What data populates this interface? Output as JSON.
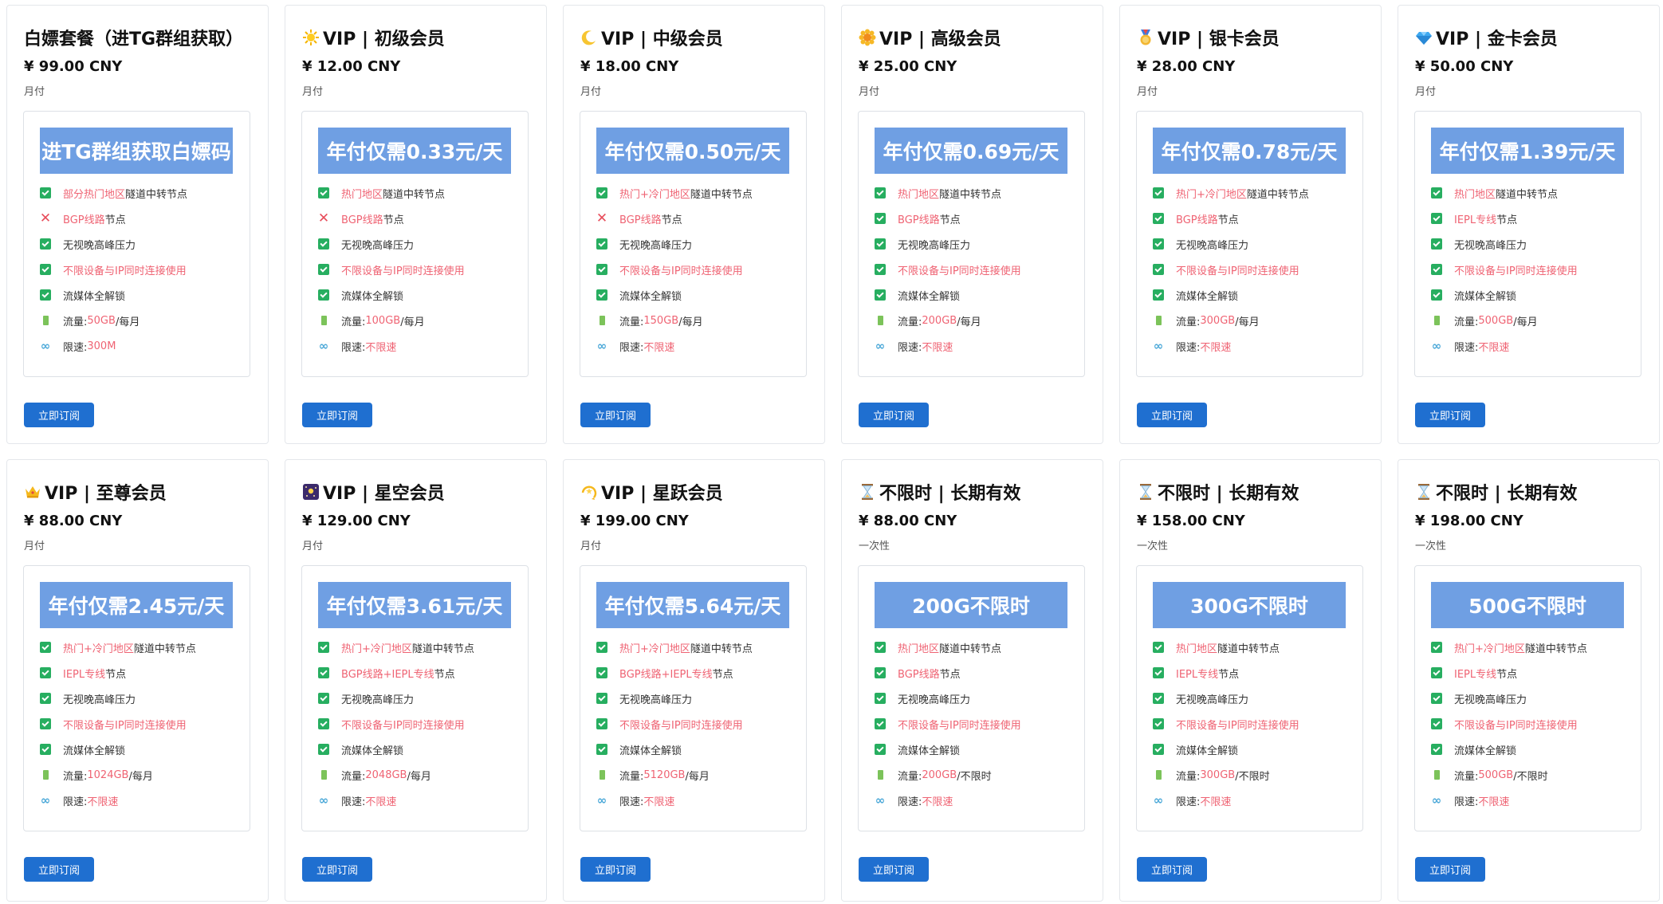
{
  "button_label": "立即订阅",
  "cards": [
    {
      "title": "白嫖套餐（进TG群组获取）",
      "emoji": "",
      "price": "¥ 99.00 CNY",
      "period": "月付",
      "banner": "进TG群组获取白嫖码",
      "features": [
        {
          "icon": "check-icon",
          "red": "部分热门地区",
          "text": " 隧道中转节点"
        },
        {
          "icon": "cross-icon",
          "red": "BGP线路",
          "text": "节点"
        },
        {
          "icon": "check-icon",
          "red": "",
          "text": "无视晚高峰压力"
        },
        {
          "icon": "check-icon",
          "red": "不限设备与IP同时连接使用",
          "text": ""
        },
        {
          "icon": "check-icon",
          "red": "",
          "text": "流媒体全解锁"
        },
        {
          "icon": "battery-icon",
          "text": "流量:",
          "red": "50GB",
          "suffix": " /每月"
        },
        {
          "icon": "infinity-icon",
          "text": "限速:",
          "red": "300M"
        }
      ]
    },
    {
      "title": "VIP | 初级会员",
      "emoji": "sun",
      "price": "¥ 12.00 CNY",
      "period": "月付",
      "banner": "年付仅需0.33元/天",
      "features": [
        {
          "icon": "check-icon",
          "red": "热门地区",
          "text": " 隧道中转节点"
        },
        {
          "icon": "cross-icon",
          "red": "BGP线路",
          "text": "节点"
        },
        {
          "icon": "check-icon",
          "red": "",
          "text": "无视晚高峰压力"
        },
        {
          "icon": "check-icon",
          "red": "不限设备与IP同时连接使用",
          "text": ""
        },
        {
          "icon": "check-icon",
          "red": "",
          "text": "流媒体全解锁"
        },
        {
          "icon": "battery-icon",
          "text": "流量:",
          "red": "100GB",
          "suffix": " /每月"
        },
        {
          "icon": "infinity-icon",
          "text": "限速:",
          "red": "不限速"
        }
      ]
    },
    {
      "title": "VIP | 中级会员",
      "emoji": "moon",
      "price": "¥ 18.00 CNY",
      "period": "月付",
      "banner": "年付仅需0.50元/天",
      "features": [
        {
          "icon": "check-icon",
          "red": "热门+冷门地区",
          "text": " 隧道中转节点"
        },
        {
          "icon": "cross-icon",
          "red": "BGP线路",
          "text": "节点"
        },
        {
          "icon": "check-icon",
          "red": "",
          "text": "无视晚高峰压力"
        },
        {
          "icon": "check-icon",
          "red": "不限设备与IP同时连接使用",
          "text": ""
        },
        {
          "icon": "check-icon",
          "red": "",
          "text": "流媒体全解锁"
        },
        {
          "icon": "battery-icon",
          "text": "流量:",
          "red": "150GB",
          "suffix": " /每月"
        },
        {
          "icon": "infinity-icon",
          "text": "限速:",
          "red": "不限速"
        }
      ]
    },
    {
      "title": "VIP | 高级会员",
      "emoji": "sunflower",
      "price": "¥ 25.00 CNY",
      "period": "月付",
      "banner": "年付仅需0.69元/天",
      "features": [
        {
          "icon": "check-icon",
          "red": "热门地区",
          "text": " 隧道中转节点"
        },
        {
          "icon": "check-icon",
          "red": "BGP线路",
          "text": "节点"
        },
        {
          "icon": "check-icon",
          "red": "",
          "text": "无视晚高峰压力"
        },
        {
          "icon": "check-icon",
          "red": "不限设备与IP同时连接使用",
          "text": ""
        },
        {
          "icon": "check-icon",
          "red": "",
          "text": "流媒体全解锁"
        },
        {
          "icon": "battery-icon",
          "text": "流量:",
          "red": "200GB",
          "suffix": " /每月"
        },
        {
          "icon": "infinity-icon",
          "text": "限速:",
          "red": "不限速"
        }
      ]
    },
    {
      "title": "VIP | 银卡会员",
      "emoji": "medal",
      "price": "¥ 28.00 CNY",
      "period": "月付",
      "banner": "年付仅需0.78元/天",
      "features": [
        {
          "icon": "check-icon",
          "red": "热门+冷门地区",
          "text": " 隧道中转节点"
        },
        {
          "icon": "check-icon",
          "red": "BGP线路",
          "text": "节点"
        },
        {
          "icon": "check-icon",
          "red": "",
          "text": "无视晚高峰压力"
        },
        {
          "icon": "check-icon",
          "red": "不限设备与IP同时连接使用",
          "text": ""
        },
        {
          "icon": "check-icon",
          "red": "",
          "text": "流媒体全解锁"
        },
        {
          "icon": "battery-icon",
          "text": "流量:",
          "red": "300GB",
          "suffix": " /每月"
        },
        {
          "icon": "infinity-icon",
          "text": "限速:",
          "red": "不限速"
        }
      ]
    },
    {
      "title": "VIP | 金卡会员",
      "emoji": "diamond",
      "price": "¥ 50.00 CNY",
      "period": "月付",
      "banner": "年付仅需1.39元/天",
      "features": [
        {
          "icon": "check-icon",
          "red": "热门地区",
          "text": " 隧道中转节点"
        },
        {
          "icon": "check-icon",
          "red": "IEPL专线",
          "text": "节点"
        },
        {
          "icon": "check-icon",
          "red": "",
          "text": "无视晚高峰压力"
        },
        {
          "icon": "check-icon",
          "red": "不限设备与IP同时连接使用",
          "text": ""
        },
        {
          "icon": "check-icon",
          "red": "",
          "text": "流媒体全解锁"
        },
        {
          "icon": "battery-icon",
          "text": "流量:",
          "red": "500GB",
          "suffix": " /每月"
        },
        {
          "icon": "infinity-icon",
          "text": "限速:",
          "red": "不限速"
        }
      ]
    },
    {
      "title": "VIP | 至尊会员",
      "emoji": "crown",
      "price": "¥ 88.00 CNY",
      "period": "月付",
      "banner": "年付仅需2.45元/天",
      "features": [
        {
          "icon": "check-icon",
          "red": "热门+冷门地区",
          "text": " 隧道中转节点"
        },
        {
          "icon": "check-icon",
          "red": "IEPL专线",
          "text": "节点"
        },
        {
          "icon": "check-icon",
          "red": "",
          "text": "无视晚高峰压力"
        },
        {
          "icon": "check-icon",
          "red": "不限设备与IP同时连接使用",
          "text": ""
        },
        {
          "icon": "check-icon",
          "red": "",
          "text": "流媒体全解锁"
        },
        {
          "icon": "battery-icon",
          "text": "流量:",
          "red": "1024GB",
          "suffix": " /每月"
        },
        {
          "icon": "infinity-icon",
          "text": "限速:",
          "red": "不限速"
        }
      ]
    },
    {
      "title": "VIP | 星空会员",
      "emoji": "night",
      "price": "¥ 129.00 CNY",
      "period": "月付",
      "banner": "年付仅需3.61元/天",
      "features": [
        {
          "icon": "check-icon",
          "red": "热门+冷门地区",
          "text": " 隧道中转节点"
        },
        {
          "icon": "check-icon",
          "red": "BGP线路+IEPL专线",
          "text": "节点"
        },
        {
          "icon": "check-icon",
          "red": "",
          "text": "无视晚高峰压力"
        },
        {
          "icon": "check-icon",
          "red": "不限设备与IP同时连接使用",
          "text": ""
        },
        {
          "icon": "check-icon",
          "red": "",
          "text": "流媒体全解锁"
        },
        {
          "icon": "battery-icon",
          "text": "流量:",
          "red": "2048GB",
          "suffix": " /每月"
        },
        {
          "icon": "infinity-icon",
          "text": "限速:",
          "red": "不限速"
        }
      ]
    },
    {
      "title": "VIP | 星跃会员",
      "emoji": "dizzy",
      "price": "¥ 199.00 CNY",
      "period": "月付",
      "banner": "年付仅需5.64元/天",
      "features": [
        {
          "icon": "check-icon",
          "red": "热门+冷门地区",
          "text": " 隧道中转节点"
        },
        {
          "icon": "check-icon",
          "red": "BGP线路+IEPL专线",
          "text": "节点"
        },
        {
          "icon": "check-icon",
          "red": "",
          "text": "无视晚高峰压力"
        },
        {
          "icon": "check-icon",
          "red": "不限设备与IP同时连接使用",
          "text": ""
        },
        {
          "icon": "check-icon",
          "red": "",
          "text": "流媒体全解锁"
        },
        {
          "icon": "battery-icon",
          "text": "流量:",
          "red": "5120GB",
          "suffix": " /每月"
        },
        {
          "icon": "infinity-icon",
          "text": "限速:",
          "red": "不限速"
        }
      ]
    },
    {
      "title": "不限时 | 长期有效",
      "emoji": "hourglass",
      "price": "¥ 88.00 CNY",
      "period": "一次性",
      "banner": "200G不限时",
      "features": [
        {
          "icon": "check-icon",
          "red": "热门地区",
          "text": " 隧道中转节点"
        },
        {
          "icon": "check-icon",
          "red": "BGP线路",
          "text": "节点"
        },
        {
          "icon": "check-icon",
          "red": "",
          "text": "无视晚高峰压力"
        },
        {
          "icon": "check-icon",
          "red": "不限设备与IP同时连接使用",
          "text": ""
        },
        {
          "icon": "check-icon",
          "red": "",
          "text": "流媒体全解锁"
        },
        {
          "icon": "battery-icon",
          "text": "流量:",
          "red": "200GB",
          "suffix": " /不限时"
        },
        {
          "icon": "infinity-icon",
          "text": "限速:",
          "red": "不限速"
        }
      ]
    },
    {
      "title": "不限时 | 长期有效",
      "emoji": "hourglass",
      "price": "¥ 158.00 CNY",
      "period": "一次性",
      "banner": "300G不限时",
      "features": [
        {
          "icon": "check-icon",
          "red": "热门地区",
          "text": " 隧道中转节点"
        },
        {
          "icon": "check-icon",
          "red": "IEPL专线",
          "text": "节点"
        },
        {
          "icon": "check-icon",
          "red": "",
          "text": "无视晚高峰压力"
        },
        {
          "icon": "check-icon",
          "red": "不限设备与IP同时连接使用",
          "text": ""
        },
        {
          "icon": "check-icon",
          "red": "",
          "text": "流媒体全解锁"
        },
        {
          "icon": "battery-icon",
          "text": "流量:",
          "red": "300GB",
          "suffix": " /不限时"
        },
        {
          "icon": "infinity-icon",
          "text": "限速:",
          "red": "不限速"
        }
      ]
    },
    {
      "title": "不限时 | 长期有效",
      "emoji": "hourglass",
      "price": "¥ 198.00 CNY",
      "period": "一次性",
      "banner": "500G不限时",
      "features": [
        {
          "icon": "check-icon",
          "red": "热门+冷门地区",
          "text": " 隧道中转节点"
        },
        {
          "icon": "check-icon",
          "red": "IEPL专线",
          "text": "节点"
        },
        {
          "icon": "check-icon",
          "red": "",
          "text": "无视晚高峰压力"
        },
        {
          "icon": "check-icon",
          "red": "不限设备与IP同时连接使用",
          "text": ""
        },
        {
          "icon": "check-icon",
          "red": "",
          "text": "流媒体全解锁"
        },
        {
          "icon": "battery-icon",
          "text": "流量:",
          "red": "500GB",
          "suffix": " /不限时"
        },
        {
          "icon": "infinity-icon",
          "text": "限速:",
          "red": "不限速"
        }
      ]
    }
  ],
  "colors": {
    "banner": "#6f9fe3",
    "button": "#1f6fd0",
    "check": "#27ae60",
    "cross": "#e74c5a",
    "highlight": "#ef6373",
    "battery": "#7cc35a",
    "infinity": "#4aa8d8"
  }
}
